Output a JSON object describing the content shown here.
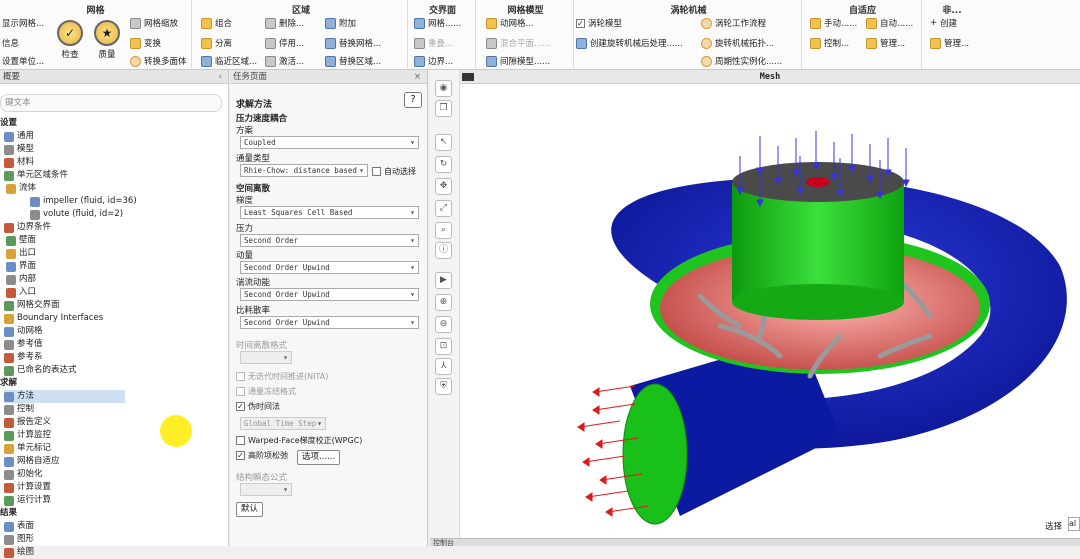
{
  "ribbon": {
    "groups": [
      {
        "title": "网格",
        "items": [
          "显示网格...",
          "信息",
          "设置单位...",
          "网格缩放",
          "变换",
          "转换多面体"
        ],
        "big": [
          "检查",
          "质量"
        ]
      },
      {
        "title": "区域",
        "items": [
          "组合",
          "分离",
          "临近区域...",
          "删除...",
          "停用...",
          "激活...",
          "附加",
          "替换网格...",
          "替换区域..."
        ]
      },
      {
        "title": "交界面",
        "items": [
          "网格......",
          "重叠...",
          "边界..."
        ]
      },
      {
        "title": "网格模型",
        "items": [
          "动网格...",
          "混合平面......",
          "间隙模型......"
        ]
      },
      {
        "title": "涡轮机械",
        "items": [
          "涡轮模型",
          "创建旋转机械后处理......",
          "涡轮工作流程",
          "旋转机械拓扑...",
          "周期性实例化......"
        ]
      },
      {
        "title": "自适应",
        "items": [
          "手动......",
          "控制...",
          "自动......",
          "管理..."
        ]
      },
      {
        "title": "非...",
        "items": [
          "创建",
          "管理..."
        ]
      }
    ]
  },
  "tree": {
    "header": "概要",
    "search_placeholder": "键文本",
    "rows": [
      {
        "label": "设置",
        "sec": true
      },
      {
        "label": "通用"
      },
      {
        "label": "模型"
      },
      {
        "label": "材料"
      },
      {
        "label": "单元区域条件"
      },
      {
        "label": "流体"
      },
      {
        "label": "impeller (fluid, id=36)"
      },
      {
        "label": "volute (fluid, id=2)"
      },
      {
        "label": "边界条件"
      },
      {
        "label": "壁面"
      },
      {
        "label": "出口"
      },
      {
        "label": "界面"
      },
      {
        "label": "内部"
      },
      {
        "label": "入口"
      },
      {
        "label": "网格交界面"
      },
      {
        "label": "Boundary Interfaces"
      },
      {
        "label": "动网格"
      },
      {
        "label": "参考值"
      },
      {
        "label": "参考系"
      },
      {
        "label": "已命名的表达式"
      },
      {
        "label": "求解",
        "sec": true
      },
      {
        "label": "方法",
        "selected": true
      },
      {
        "label": "控制"
      },
      {
        "label": "报告定义"
      },
      {
        "label": "计算监控"
      },
      {
        "label": "单元标记"
      },
      {
        "label": "网格自适应"
      },
      {
        "label": "初始化"
      },
      {
        "label": "计算设置"
      },
      {
        "label": "运行计算"
      },
      {
        "label": "结果",
        "sec": true
      },
      {
        "label": "表面"
      },
      {
        "label": "图形"
      },
      {
        "label": "绘图"
      }
    ]
  },
  "task": {
    "header": "任务页面",
    "title": "求解方法",
    "help": "?",
    "pv_coupling": "压力速度耦合",
    "scheme_label": "方案",
    "scheme_value": "Coupled",
    "flux_label": "通量类型",
    "flux_value": "Rhie-Chow: distance based",
    "auto_select": "自动选择",
    "spatial": "空间离散",
    "gradient_label": "梯度",
    "gradient_value": "Least Squares Cell Based",
    "pressure_label": "压力",
    "pressure_value": "Second Order",
    "momentum_label": "动量",
    "momentum_value": "Second Order Upwind",
    "tke_label": "湍流动能",
    "tke_value": "Second Order Upwind",
    "sdr_label": "比耗散率",
    "sdr_value": "Second Order Upwind",
    "transient_label": "时间离散格式",
    "nita": "无迭代时间推进(NITA)",
    "frozen_flux": "通量冻结格式",
    "pseudo": "伪时间法",
    "pseudo_dd": "Global Time Step",
    "wpgc": "Warped-Face梯度校正(WPGC)",
    "high_order": "高阶项松弛",
    "options_btn": "选项......",
    "structure_label": "结构瞬态公式",
    "default_btn": "默认"
  },
  "graphics": {
    "title": "Mesh",
    "select_label": "选择",
    "select_value": "al",
    "bottom": "控制台",
    "colors": {
      "volute": "#0a1aa0",
      "inner": "#1d2fc8",
      "green": "#1fc41f",
      "impeller": "#e06a66",
      "top": "#555555",
      "arrow_in": "#3a3ad8",
      "arrow_out": "#e01818"
    }
  }
}
